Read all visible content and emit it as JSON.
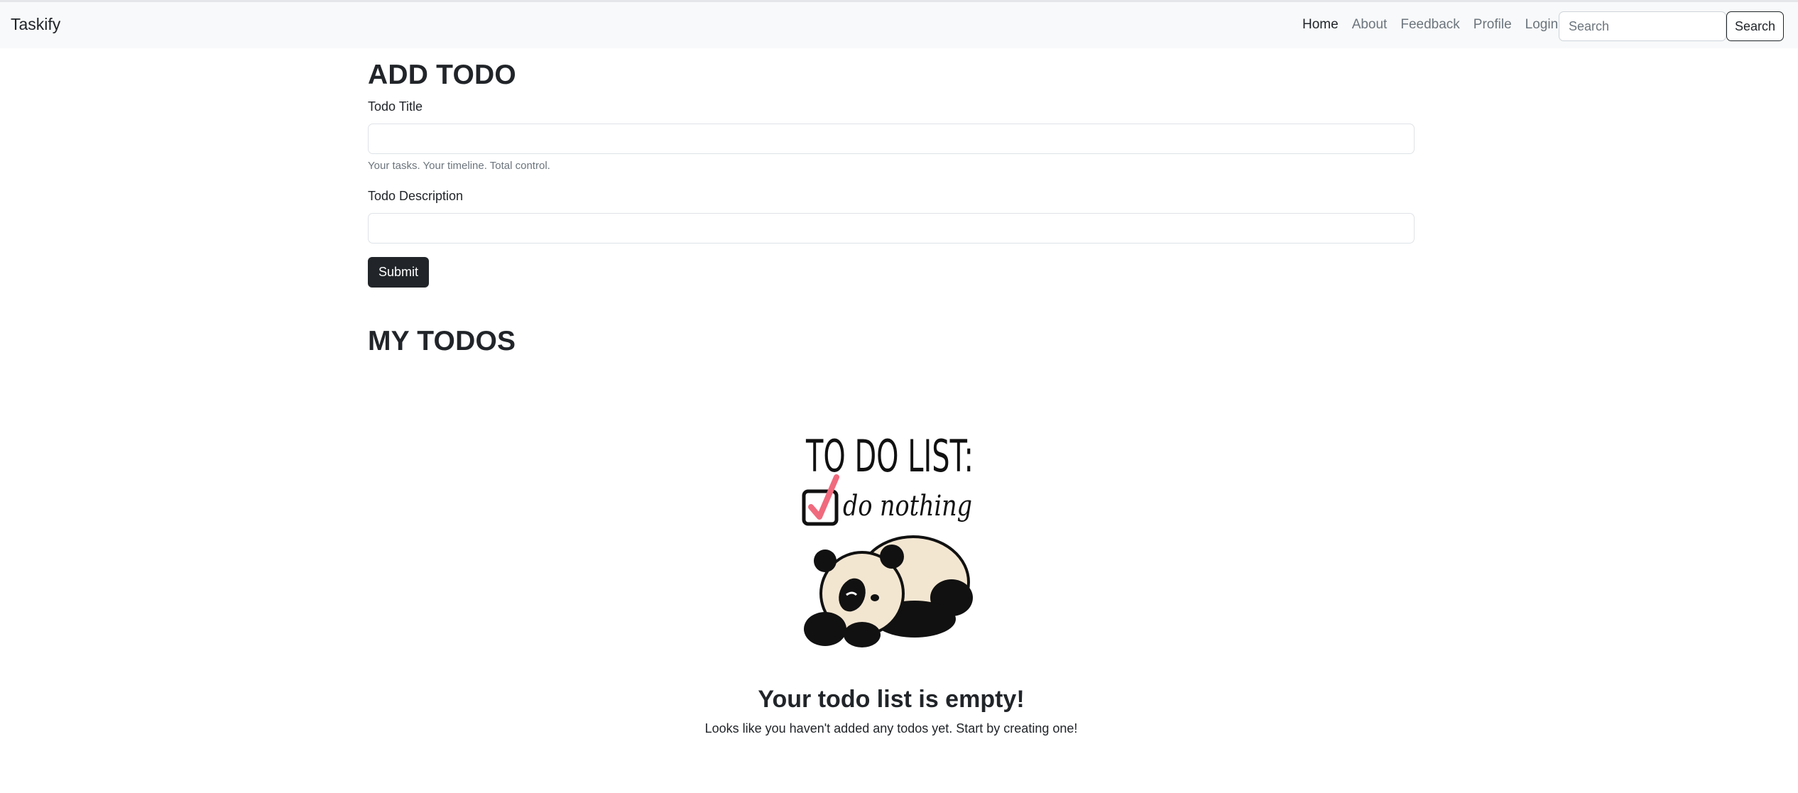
{
  "navbar": {
    "brand": "Taskify",
    "links": [
      {
        "label": "Home",
        "active": true
      },
      {
        "label": "About",
        "active": false
      },
      {
        "label": "Feedback",
        "active": false
      },
      {
        "label": "Profile",
        "active": false
      },
      {
        "label": "Login",
        "active": false
      }
    ],
    "search_placeholder": "Search",
    "search_button": "Search"
  },
  "add_todo": {
    "heading": "ADD TODO",
    "title_label": "Todo Title",
    "title_value": "",
    "title_help": "Your tasks. Your timeline. Total control.",
    "description_label": "Todo Description",
    "description_value": "",
    "submit_label": "Submit"
  },
  "my_todos": {
    "heading": "MY TODOS",
    "illustration": {
      "line1": "TO DO LIST:",
      "line2": "do nothing",
      "icons": [
        "checked-box-icon",
        "sleeping-panda-icon"
      ]
    },
    "empty_title": "Your todo list is empty!",
    "empty_text": "Looks like you haven't added any todos yet. Start by creating one!"
  },
  "colors": {
    "navbar_bg": "#f8f9fa",
    "text_dark": "#212529",
    "text_muted": "#6c757d",
    "check_red": "#f06a7d",
    "panda_cream": "#f3e6d1"
  }
}
